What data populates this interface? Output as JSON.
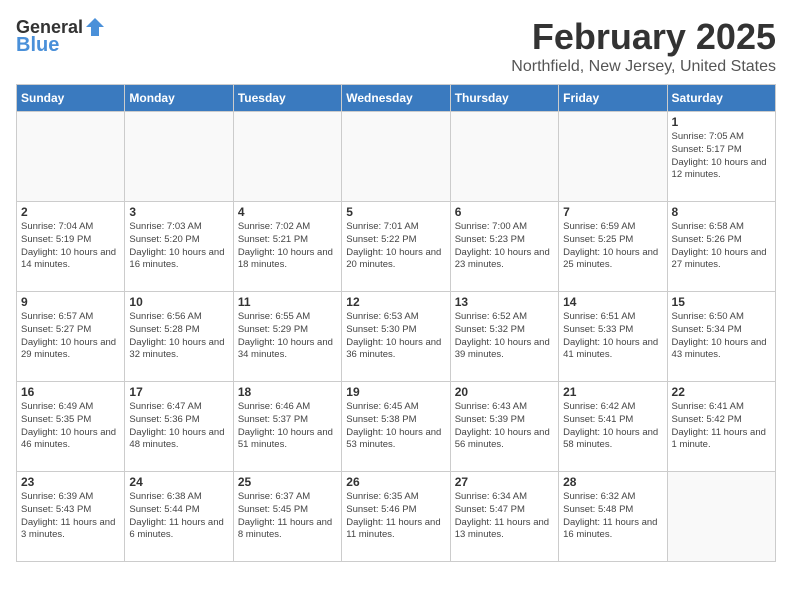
{
  "header": {
    "logo_general": "General",
    "logo_blue": "Blue",
    "title": "February 2025",
    "location": "Northfield, New Jersey, United States"
  },
  "days_of_week": [
    "Sunday",
    "Monday",
    "Tuesday",
    "Wednesday",
    "Thursday",
    "Friday",
    "Saturday"
  ],
  "weeks": [
    [
      {
        "num": "",
        "info": ""
      },
      {
        "num": "",
        "info": ""
      },
      {
        "num": "",
        "info": ""
      },
      {
        "num": "",
        "info": ""
      },
      {
        "num": "",
        "info": ""
      },
      {
        "num": "",
        "info": ""
      },
      {
        "num": "1",
        "info": "Sunrise: 7:05 AM\nSunset: 5:17 PM\nDaylight: 10 hours\nand 12 minutes."
      }
    ],
    [
      {
        "num": "2",
        "info": "Sunrise: 7:04 AM\nSunset: 5:19 PM\nDaylight: 10 hours\nand 14 minutes."
      },
      {
        "num": "3",
        "info": "Sunrise: 7:03 AM\nSunset: 5:20 PM\nDaylight: 10 hours\nand 16 minutes."
      },
      {
        "num": "4",
        "info": "Sunrise: 7:02 AM\nSunset: 5:21 PM\nDaylight: 10 hours\nand 18 minutes."
      },
      {
        "num": "5",
        "info": "Sunrise: 7:01 AM\nSunset: 5:22 PM\nDaylight: 10 hours\nand 20 minutes."
      },
      {
        "num": "6",
        "info": "Sunrise: 7:00 AM\nSunset: 5:23 PM\nDaylight: 10 hours\nand 23 minutes."
      },
      {
        "num": "7",
        "info": "Sunrise: 6:59 AM\nSunset: 5:25 PM\nDaylight: 10 hours\nand 25 minutes."
      },
      {
        "num": "8",
        "info": "Sunrise: 6:58 AM\nSunset: 5:26 PM\nDaylight: 10 hours\nand 27 minutes."
      }
    ],
    [
      {
        "num": "9",
        "info": "Sunrise: 6:57 AM\nSunset: 5:27 PM\nDaylight: 10 hours\nand 29 minutes."
      },
      {
        "num": "10",
        "info": "Sunrise: 6:56 AM\nSunset: 5:28 PM\nDaylight: 10 hours\nand 32 minutes."
      },
      {
        "num": "11",
        "info": "Sunrise: 6:55 AM\nSunset: 5:29 PM\nDaylight: 10 hours\nand 34 minutes."
      },
      {
        "num": "12",
        "info": "Sunrise: 6:53 AM\nSunset: 5:30 PM\nDaylight: 10 hours\nand 36 minutes."
      },
      {
        "num": "13",
        "info": "Sunrise: 6:52 AM\nSunset: 5:32 PM\nDaylight: 10 hours\nand 39 minutes."
      },
      {
        "num": "14",
        "info": "Sunrise: 6:51 AM\nSunset: 5:33 PM\nDaylight: 10 hours\nand 41 minutes."
      },
      {
        "num": "15",
        "info": "Sunrise: 6:50 AM\nSunset: 5:34 PM\nDaylight: 10 hours\nand 43 minutes."
      }
    ],
    [
      {
        "num": "16",
        "info": "Sunrise: 6:49 AM\nSunset: 5:35 PM\nDaylight: 10 hours\nand 46 minutes."
      },
      {
        "num": "17",
        "info": "Sunrise: 6:47 AM\nSunset: 5:36 PM\nDaylight: 10 hours\nand 48 minutes."
      },
      {
        "num": "18",
        "info": "Sunrise: 6:46 AM\nSunset: 5:37 PM\nDaylight: 10 hours\nand 51 minutes."
      },
      {
        "num": "19",
        "info": "Sunrise: 6:45 AM\nSunset: 5:38 PM\nDaylight: 10 hours\nand 53 minutes."
      },
      {
        "num": "20",
        "info": "Sunrise: 6:43 AM\nSunset: 5:39 PM\nDaylight: 10 hours\nand 56 minutes."
      },
      {
        "num": "21",
        "info": "Sunrise: 6:42 AM\nSunset: 5:41 PM\nDaylight: 10 hours\nand 58 minutes."
      },
      {
        "num": "22",
        "info": "Sunrise: 6:41 AM\nSunset: 5:42 PM\nDaylight: 11 hours\nand 1 minute."
      }
    ],
    [
      {
        "num": "23",
        "info": "Sunrise: 6:39 AM\nSunset: 5:43 PM\nDaylight: 11 hours\nand 3 minutes."
      },
      {
        "num": "24",
        "info": "Sunrise: 6:38 AM\nSunset: 5:44 PM\nDaylight: 11 hours\nand 6 minutes."
      },
      {
        "num": "25",
        "info": "Sunrise: 6:37 AM\nSunset: 5:45 PM\nDaylight: 11 hours\nand 8 minutes."
      },
      {
        "num": "26",
        "info": "Sunrise: 6:35 AM\nSunset: 5:46 PM\nDaylight: 11 hours\nand 11 minutes."
      },
      {
        "num": "27",
        "info": "Sunrise: 6:34 AM\nSunset: 5:47 PM\nDaylight: 11 hours\nand 13 minutes."
      },
      {
        "num": "28",
        "info": "Sunrise: 6:32 AM\nSunset: 5:48 PM\nDaylight: 11 hours\nand 16 minutes."
      },
      {
        "num": "",
        "info": ""
      }
    ]
  ]
}
